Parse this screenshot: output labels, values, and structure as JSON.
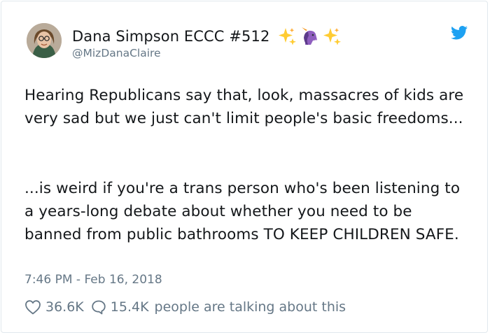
{
  "tweet": {
    "author": {
      "display_name": "Dana Simpson ECCC #512",
      "handle": "@MizDanaClaire"
    },
    "icons": {
      "name_emojis": [
        "sparkles-icon",
        "unicorn-icon",
        "sparkles-icon"
      ],
      "platform": "twitter-bird-icon"
    },
    "paragraphs": [
      "Hearing Republicans say that, look, massacres of kids are very sad but we just can't limit people's basic freedoms...",
      "...is weird if you're a trans person who's been listening to a years-long debate about whether you need to be banned from public bathrooms TO KEEP CHILDREN SAFE."
    ],
    "timestamp": "7:46 PM - Feb 16, 2018",
    "likes": "36.6K",
    "replies": "15.4K",
    "talking_label": "people are talking about this",
    "colors": {
      "text": "#14171a",
      "secondary": "#657786",
      "twitter_blue": "#1da1f2",
      "border": "#e1e8ed"
    }
  }
}
